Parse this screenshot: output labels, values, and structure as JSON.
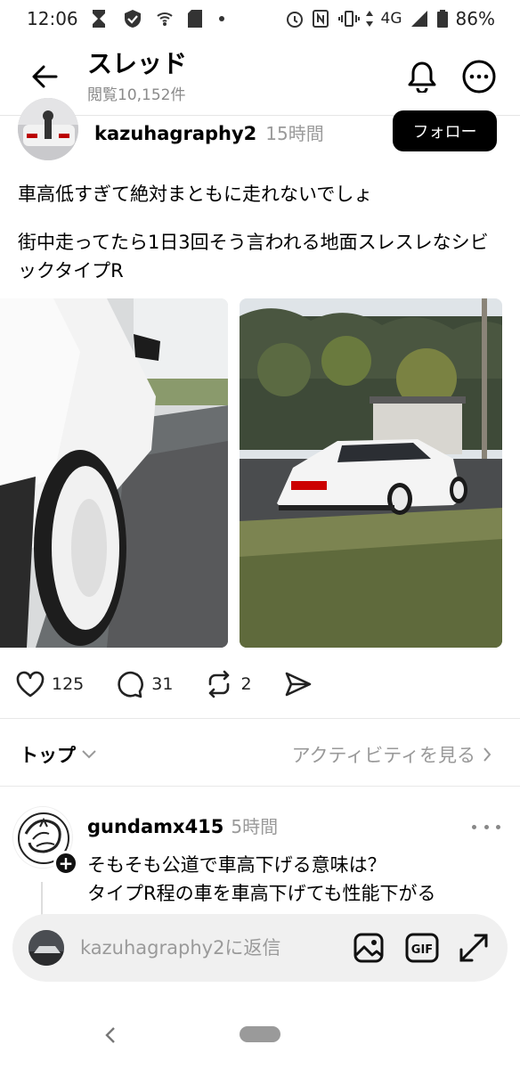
{
  "status_bar": {
    "time": "12:06",
    "network": "4G",
    "battery": "86%"
  },
  "header": {
    "title": "スレッド",
    "views": "閲覧10,152件"
  },
  "post": {
    "username": "kazuhagraphy2",
    "time": "15時間",
    "follow_label": "フォロー",
    "text_line1": "車高低すぎて絶対まともに走れないでしょ",
    "text_line2": "街中走ってたら1日3回そう言われる地面スレスレなシビックタイプR",
    "likes": "125",
    "comments": "31",
    "reposts": "2"
  },
  "sort": {
    "label": "トップ",
    "activity_link": "アクティビティを見る"
  },
  "reply": {
    "username": "gundamx415",
    "time": "5時間",
    "text_line1": "そもそも公道で車高下げる意味は？",
    "text_line2": "タイプR程の車を車高下げても性能下がる"
  },
  "composer": {
    "placeholder": "kazuhagraphy2に返信"
  },
  "icons": {
    "back": "arrow-left-icon",
    "bell": "bell-icon",
    "more": "more-icon",
    "heart": "heart-icon",
    "comment": "comment-icon",
    "repost": "repost-icon",
    "share": "share-icon",
    "image": "image-icon",
    "gif": "gif-icon",
    "expand": "expand-icon"
  }
}
